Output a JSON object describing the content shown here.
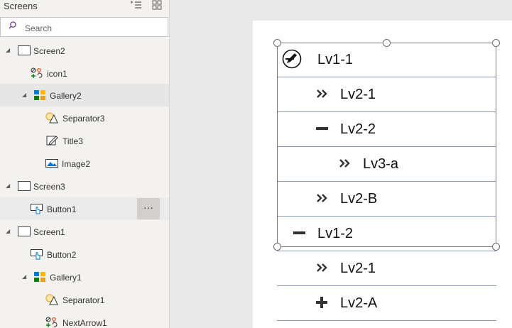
{
  "tree": {
    "title": "Screens",
    "search_placeholder": "Search",
    "nodes": [
      {
        "label": "Screen2"
      },
      {
        "label": "icon1"
      },
      {
        "label": "Gallery2"
      },
      {
        "label": "Separator3"
      },
      {
        "label": "Title3"
      },
      {
        "label": "Image2"
      },
      {
        "label": "Screen3"
      },
      {
        "label": "Button1"
      },
      {
        "label": "Screen1"
      },
      {
        "label": "Button2"
      },
      {
        "label": "Gallery1"
      },
      {
        "label": "Separator1"
      },
      {
        "label": "NextArrow1"
      }
    ],
    "more_label": "···"
  },
  "gallery": {
    "rows": [
      {
        "icon": "edit-icon",
        "text": "Lv1-1"
      },
      {
        "icon": "double-chevron-icon",
        "text": "Lv2-1"
      },
      {
        "icon": "minus-icon",
        "text": "Lv2-2"
      },
      {
        "icon": "double-chevron-icon",
        "text": "Lv3-a"
      },
      {
        "icon": "double-chevron-icon",
        "text": "Lv2-B"
      },
      {
        "icon": "minus-icon",
        "text": "Lv1-2"
      },
      {
        "icon": "double-chevron-icon",
        "text": "Lv2-1"
      },
      {
        "icon": "plus-icon",
        "text": "Lv2-A"
      }
    ]
  },
  "colors": {
    "panel_bg": "#f3f2f1",
    "selected_row": "#e6e6e6",
    "canvas_bg": "#e9e9e9",
    "row_divider": "#8a98b4"
  }
}
